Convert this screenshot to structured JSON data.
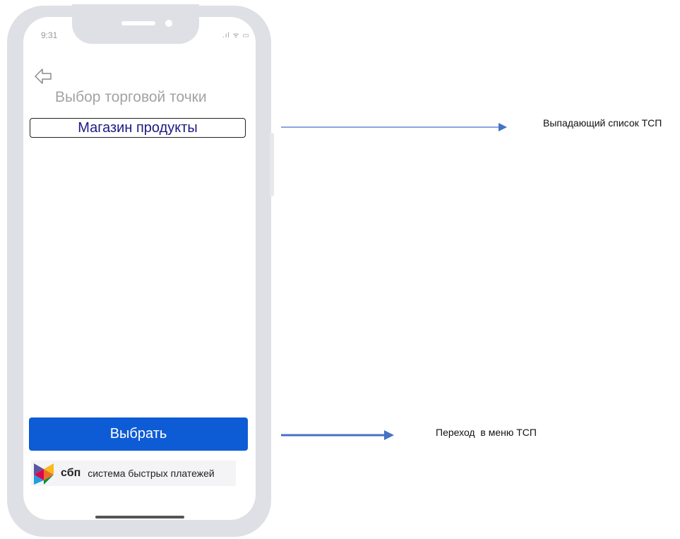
{
  "status_bar": {
    "time": "9:31",
    "icons": ".ıl ᯤ ▭"
  },
  "screen": {
    "title": "Выбор торговой точки",
    "dropdown_value": "Магазин продукты",
    "select_button_label": "Выбрать"
  },
  "sbp_logo": {
    "abbr": "сбп",
    "full_name": "система быстрых платежей"
  },
  "annotations": {
    "dropdown_note": "Выпадающий список ТСП",
    "button_note": "Переход  в меню ТСП"
  },
  "colors": {
    "accent": "#0e5bd6",
    "annotation_arrow": "#4472c4",
    "dropdown_text": "#1d1a80",
    "phone_frame": "#dfe0e5"
  },
  "icons": {
    "back": "back-arrow-icon",
    "signal": "signal-icon",
    "wifi": "wifi-icon",
    "battery": "battery-icon",
    "sbp": "sbp-logo-icon"
  }
}
